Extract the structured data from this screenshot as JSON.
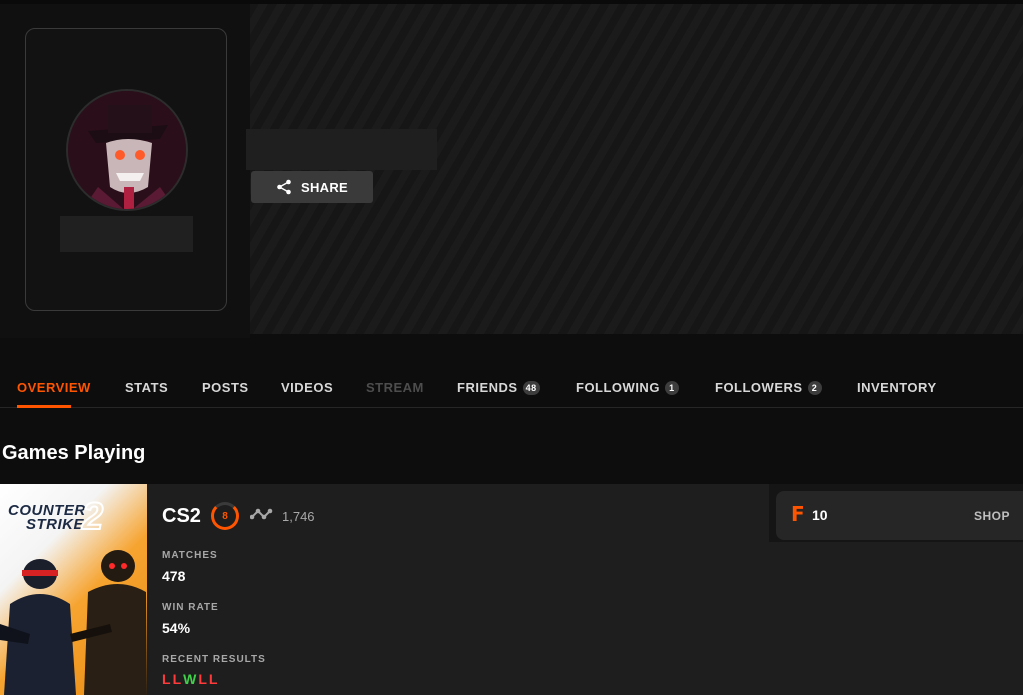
{
  "profile": {
    "share_label": "SHARE"
  },
  "tabs": [
    {
      "label": "OVERVIEW",
      "state": "active"
    },
    {
      "label": "STATS"
    },
    {
      "label": "POSTS"
    },
    {
      "label": "VIDEOS"
    },
    {
      "label": "STREAM",
      "state": "disabled"
    },
    {
      "label": "FRIENDS",
      "badge": "48"
    },
    {
      "label": "FOLLOWING",
      "badge": "1"
    },
    {
      "label": "FOLLOWERS",
      "badge": "2"
    },
    {
      "label": "INVENTORY"
    }
  ],
  "section_title": "Games Playing",
  "game": {
    "cover_title_line1": "COUNTER",
    "cover_title_line2": "STRIKE",
    "cover_number": "2",
    "name": "CS2",
    "level": "8",
    "elo": "1,746",
    "matches_label": "MATCHES",
    "matches_value": "478",
    "win_rate_label": "WIN RATE",
    "win_rate_value": "54%",
    "recent_results_label": "RECENT RESULTS",
    "recent_results": [
      "L",
      "L",
      "W",
      "L",
      "L"
    ]
  },
  "shop": {
    "currency_icon": "F",
    "points": "10",
    "link_label": "SHOP"
  },
  "colors": {
    "accent": "#ff5500",
    "loss": "#ff3a3a",
    "win": "#40d04a"
  }
}
